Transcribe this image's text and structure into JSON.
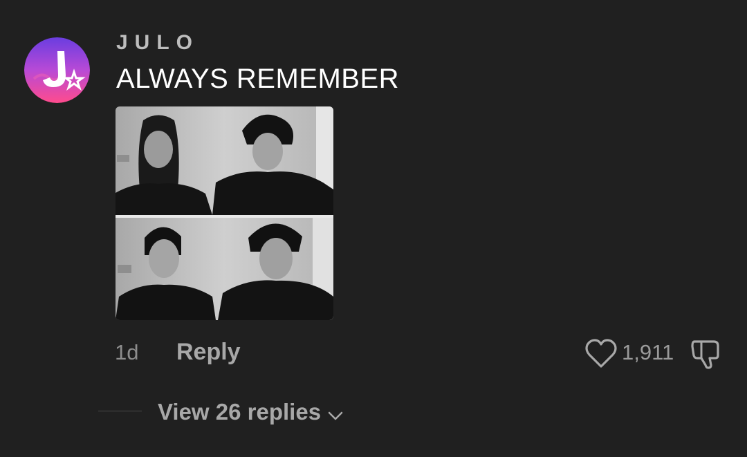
{
  "comment": {
    "username": "JULO",
    "text": "ALWAYS REMEMBER",
    "avatar_icon": "julo-star-logo",
    "image_description_icon": "photo-collage"
  },
  "meta": {
    "timestamp": "1d",
    "reply_label": "Reply",
    "like_count": "1,911",
    "like_icon": "heart-outline-icon",
    "dislike_icon": "thumbs-down-icon"
  },
  "replies": {
    "view_label": "View 26 replies",
    "chevron_icon": "chevron-down-icon"
  },
  "colors": {
    "background": "#202020",
    "username": "#bdbdbd",
    "text": "#ffffff",
    "secondary": "#a8a8a8",
    "avatar_gradient_start": "#7b3fe4",
    "avatar_gradient_end": "#ff3d8b"
  }
}
